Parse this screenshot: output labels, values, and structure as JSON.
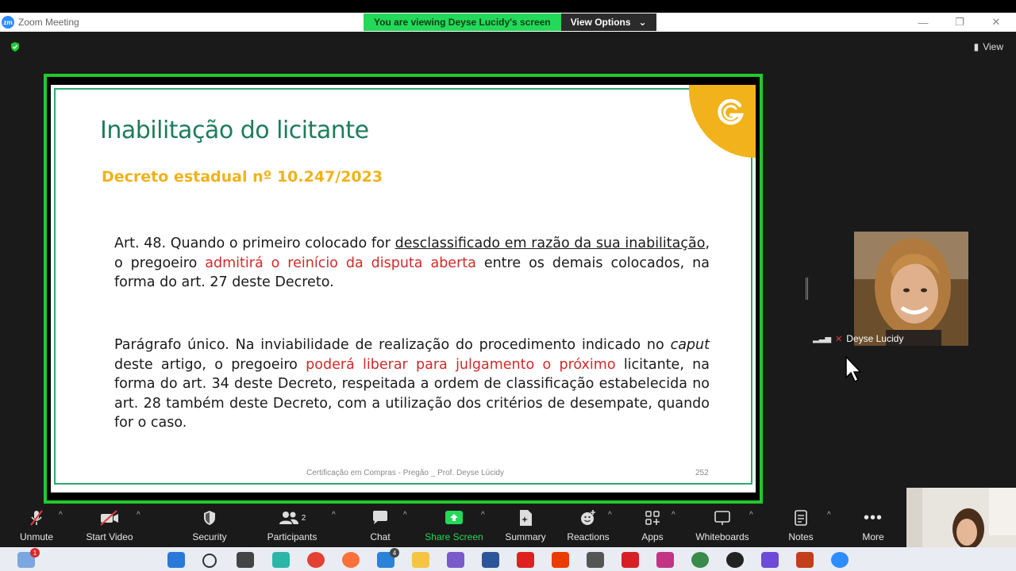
{
  "window": {
    "title": "Zoom Meeting",
    "banner_text": "You are viewing Deyse Lucidy's screen",
    "view_options": "View Options",
    "view_label": "View"
  },
  "slide": {
    "title": "Inabilitação do licitante",
    "subtitle": "Decreto estadual nº 10.247/2023",
    "p1_a": "Art. 48.  Quando o primeiro colocado for ",
    "p1_underline": "desclassificado em razão da sua inabilitação",
    "p1_b": ", o pregoeiro ",
    "p1_red": "admitirá o reinício da disputa aberta",
    "p1_c": " entre os demais colocados, na forma do art. 27 deste Decreto.",
    "p2_a": "Parágrafo único.  Na inviabilidade de realização do procedimento indicado no ",
    "p2_italic": "caput",
    "p2_b": " deste artigo, o pregoeiro ",
    "p2_red": "poderá liberar para julgamento o próximo",
    "p2_c": " licitante, na forma do art. 34 deste Decreto, respeitada a ordem de classificação estabelecida no art. 28 também deste Decreto, com a utilização dos critérios de desempate, quando for o caso.",
    "footer": "Certificação em Compras - Pregão _ Prof. Deyse Lúcidy",
    "page_number": "252",
    "accent_color": "#f2b21b",
    "title_color": "#1e7d5a"
  },
  "participant": {
    "name": "Deyse Lucidy"
  },
  "toolbar": {
    "unmute": "Unmute",
    "start_video": "Start Video",
    "security": "Security",
    "participants": "Participants",
    "participants_count": "2",
    "chat": "Chat",
    "share_screen": "Share Screen",
    "summary": "Summary",
    "reactions": "Reactions",
    "apps": "Apps",
    "whiteboards": "Whiteboards",
    "notes": "Notes",
    "more": "More"
  },
  "taskbar": {
    "notification_badge": "1",
    "mail_badge": "4"
  }
}
